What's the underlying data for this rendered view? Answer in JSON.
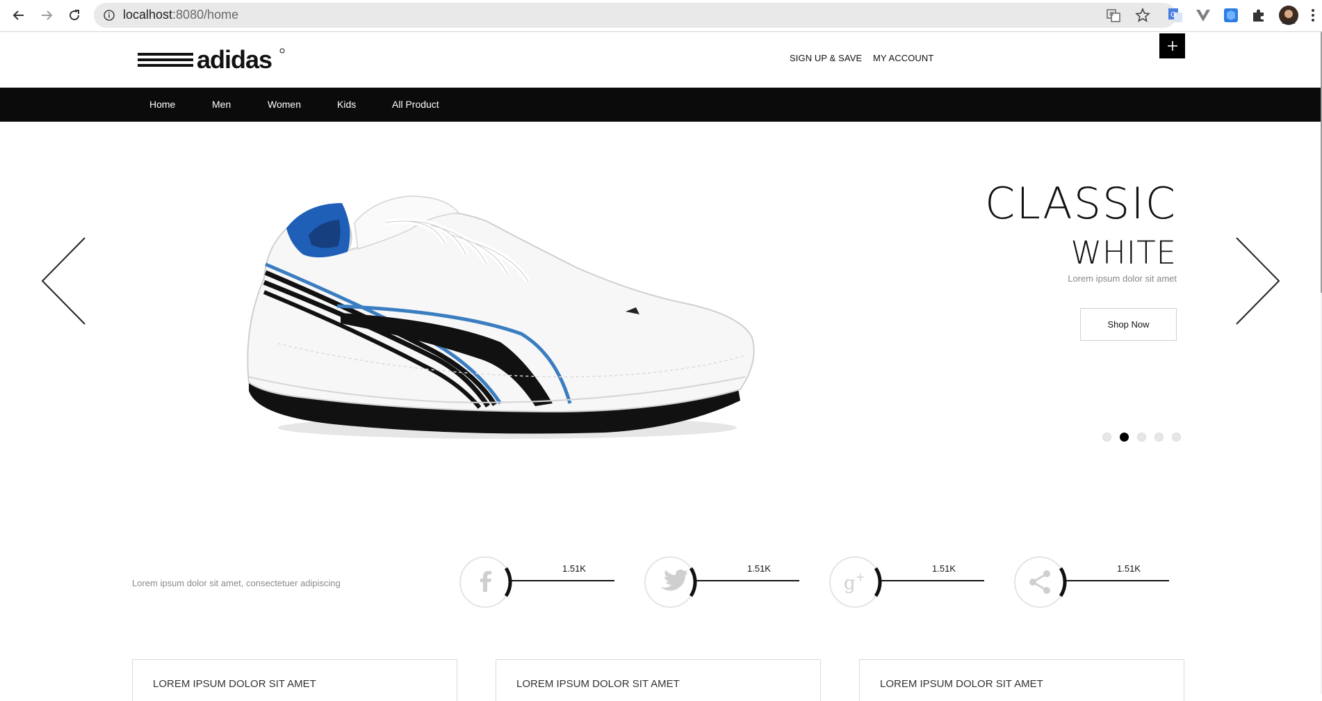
{
  "browser": {
    "url_host": "localhost",
    "url_path": ":8080/home"
  },
  "header": {
    "logo_text": "adidas",
    "signup_label": "SIGN UP & SAVE",
    "account_label": "MY ACCOUNT",
    "plus_label": "+"
  },
  "nav": {
    "items": [
      {
        "label": "Home"
      },
      {
        "label": "Men"
      },
      {
        "label": "Women"
      },
      {
        "label": "Kids"
      },
      {
        "label": "All Product"
      }
    ]
  },
  "hero": {
    "title_line1": "CLASSIC",
    "title_line2": "WHITE",
    "subtitle": "Lorem ipsum dolor sit amet",
    "button_label": "Shop Now",
    "slides_count": 5,
    "active_slide": 2
  },
  "social": {
    "tagline": "Lorem ipsum dolor sit amet, consectetuer adipiscing",
    "items": [
      {
        "icon": "facebook-icon",
        "count": "1.51K"
      },
      {
        "icon": "twitter-icon",
        "count": "1.51K"
      },
      {
        "icon": "google-plus-icon",
        "count": "1.51K"
      },
      {
        "icon": "share-icon",
        "count": "1.51K"
      }
    ]
  },
  "cards": [
    {
      "title": "LOREM IPSUM DOLOR SIT AMET"
    },
    {
      "title": "LOREM IPSUM DOLOR SIT AMET"
    },
    {
      "title": "LOREM IPSUM DOLOR SIT AMET"
    }
  ],
  "colors": {
    "nav_bg": "#0b0b0c",
    "shoe_blue": "#1f5fb8",
    "accent": "#000000"
  }
}
